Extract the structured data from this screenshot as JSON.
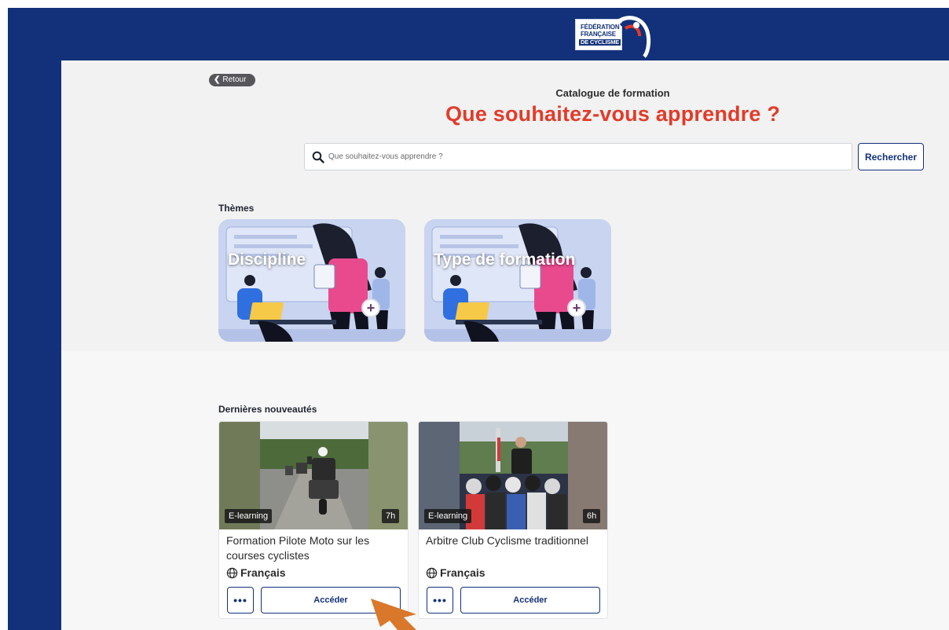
{
  "header": {
    "logo": {
      "line1": "FÉDÉRATION",
      "line2": "FRANÇAISE",
      "line3": "DE CYCLISME"
    },
    "brand_color": "#12317a"
  },
  "nav": {
    "back_label": "Retour"
  },
  "hero": {
    "eyebrow": "Catalogue de formation",
    "headline": "Que souhaitez-vous apprendre ?",
    "headline_color": "#e23b2a"
  },
  "search": {
    "placeholder": "Que souhaitez-vous apprendre ?",
    "value": "",
    "button_label": "Rechercher"
  },
  "themes": {
    "title": "Thèmes",
    "items": [
      {
        "label": "Discipline",
        "icon": "plus-icon"
      },
      {
        "label": "Type de formation",
        "icon": "plus-icon"
      }
    ]
  },
  "latest": {
    "title": "Dernières nouveautés",
    "courses": [
      {
        "title": "Formation Pilote Moto sur les courses cyclistes",
        "type_badge": "E-learning",
        "duration": "7h",
        "language": "Français",
        "more_label": "•••",
        "access_label": "Accéder"
      },
      {
        "title": "Arbitre Club Cyclisme traditionnel",
        "type_badge": "E-learning",
        "duration": "6h",
        "language": "Français",
        "more_label": "•••",
        "access_label": "Accéder"
      }
    ]
  }
}
